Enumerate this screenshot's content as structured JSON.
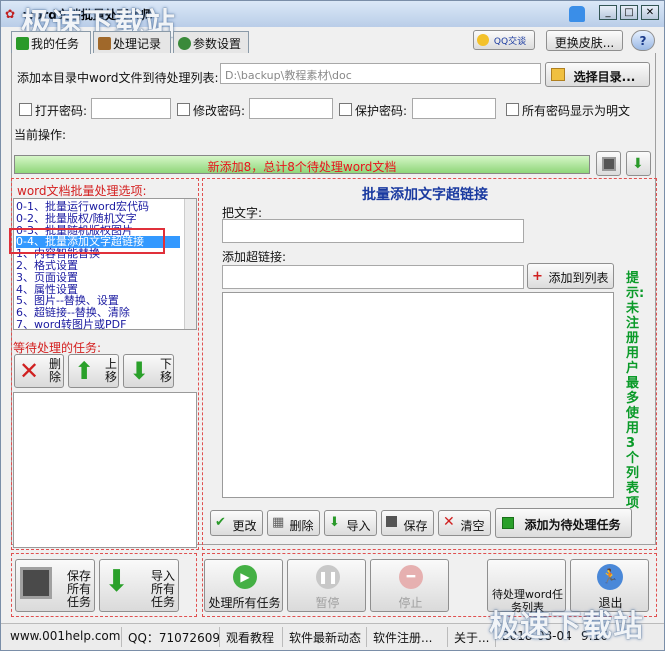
{
  "window": {
    "title": "word文档批量处理大师",
    "watermark": "极速下载站"
  },
  "titlebar_buttons": {
    "qq": "QQ交谈",
    "skin": "更换皮肤...",
    "help": "?"
  },
  "tabs": [
    "我的任务",
    "处理记录",
    "参数设置"
  ],
  "form": {
    "add_label": "添加本目录中word文件到待处理列表:",
    "dir_value": "D:\\backup\\教程素材\\doc",
    "choose_dir": "选择目录...",
    "open_pwd": "打开密码:",
    "modify_pwd": "修改密码:",
    "protect_pwd": "保护密码:",
    "show_plain": "所有密码显示为明文",
    "current_op": "当前操作:"
  },
  "progress": {
    "text": "新添加8，总计8个待处理word文档",
    "fraction": 1.0
  },
  "options": {
    "title": "word文档批量处理选项:",
    "items": [
      "0-1、批量运行word宏代码",
      "0-2、批量版权/随机文字",
      "0-3、批量随机版权图片",
      "0-4、批量添加文字超链接",
      "1、内容智能替换",
      "2、格式设置",
      "3、页面设置",
      "4、属性设置",
      "5、图片--替换、设置",
      "6、超链接--替换、清除",
      "7、word转图片或PDF"
    ],
    "selected_index": 3
  },
  "pending": {
    "title": "等待处理的任务:",
    "delete": "删除",
    "up": "上移",
    "down": "下移"
  },
  "detail": {
    "title": "批量添加文字超链接",
    "text_label": "把文字:",
    "link_label": "添加超链接:",
    "add_to_list": "添加到列表",
    "modify": "更改",
    "delete": "删除",
    "import": "导入",
    "save": "保存",
    "clear": "清空",
    "add_task": "添加为待处理任务",
    "hint": "提示:未注册用户最多使用3个列表项"
  },
  "bottom": {
    "save_all": "保存所有任务",
    "import_all": "导入所有任务",
    "run_all": "处理所有任务",
    "pause": "暂停",
    "stop": "停止",
    "pending_list": "待处理word任务列表",
    "exit": "退出"
  },
  "status": {
    "site": "www.001help.com",
    "qq": "QQ：71072609",
    "tutorial": "观看教程",
    "news": "软件最新动态",
    "register": "软件注册...",
    "about": "关于...",
    "date": "2018-08-04",
    "time": "9:16"
  }
}
